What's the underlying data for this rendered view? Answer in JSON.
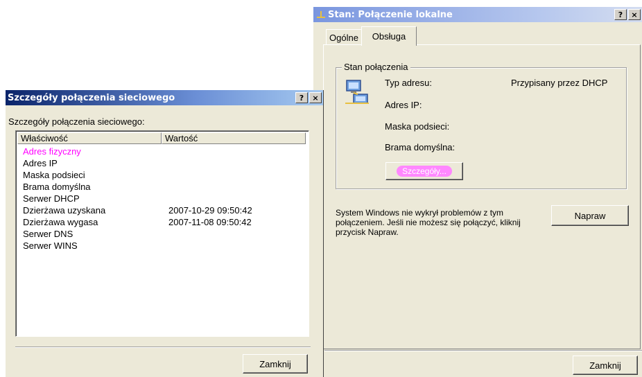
{
  "status_window": {
    "title": "Stan: Połączenie lokalne",
    "help_label": "?",
    "close_label": "×",
    "tabs": [
      {
        "label": "Ogólne"
      },
      {
        "label": "Obsługa"
      }
    ],
    "group_title": "Stan połączenia",
    "fields": [
      {
        "label": "Typ adresu:",
        "value": "Przypisany przez DHCP"
      },
      {
        "label": "Adres IP:",
        "value": ""
      },
      {
        "label": "Maska podsieci:",
        "value": ""
      },
      {
        "label": "Brama domyślna:",
        "value": ""
      }
    ],
    "details_button": "Szczegóły...",
    "message": "System Windows nie wykrył problemów z tym połączeniem. Jeśli nie możesz się połączyć, kliknij przycisk Napraw.",
    "repair_button": "Napraw",
    "close_button": "Zamknij",
    "icon": "network-connection-icon"
  },
  "details_window": {
    "title": "Szczegóły połączenia sieciowego",
    "help_label": "?",
    "close_label": "×",
    "heading": "Szczegóły połączenia sieciowego:",
    "columns": [
      "Właściwość",
      "Wartość"
    ],
    "rows": [
      {
        "property": "Adres fizyczny",
        "value": "",
        "highlight": true
      },
      {
        "property": "Adres IP",
        "value": ""
      },
      {
        "property": "Maska podsieci",
        "value": ""
      },
      {
        "property": "Brama domyślna",
        "value": ""
      },
      {
        "property": "Serwer DHCP",
        "value": ""
      },
      {
        "property": "Dzierżawa uzyskana",
        "value": "2007-10-29 09:50:42"
      },
      {
        "property": "Dzierżawa wygasa",
        "value": "2007-11-08 09:50:42"
      },
      {
        "property": "Serwer DNS",
        "value": ""
      },
      {
        "property": "Serwer WINS",
        "value": ""
      }
    ],
    "close_button": "Zamknij"
  },
  "colors": {
    "highlight_text": "#ff00ff",
    "highlight_button": "#ff88ff",
    "window_face": "#ece9d8"
  }
}
